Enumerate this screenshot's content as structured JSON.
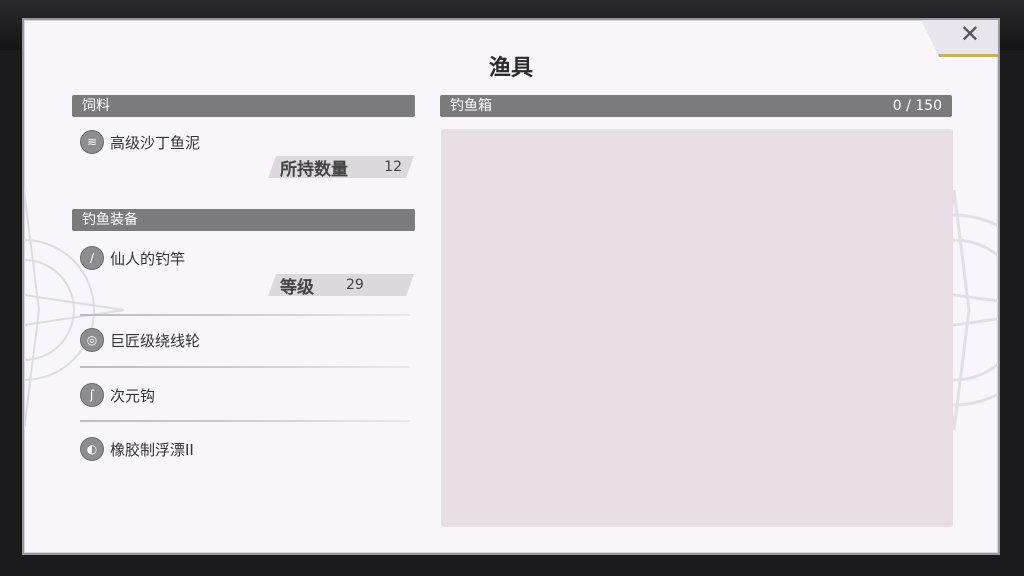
{
  "title": "渔具",
  "close": {
    "icon": "close-icon"
  },
  "bait": {
    "header": "饲料",
    "item": {
      "name": "高级沙丁鱼泥",
      "icon": "bait-icon"
    },
    "stat": {
      "label": "所持数量",
      "value": "12"
    }
  },
  "gear": {
    "header": "钓鱼装备",
    "rod": {
      "name": "仙人的钓竿",
      "icon": "rod-icon",
      "stat": {
        "label": "等级",
        "value": "29"
      }
    },
    "reel": {
      "name": "巨匠级绕线轮",
      "icon": "reel-icon"
    },
    "hook": {
      "name": "次元钩",
      "icon": "hook-icon"
    },
    "float": {
      "name": "橡胶制浮漂II",
      "icon": "float-icon"
    }
  },
  "tackle_box": {
    "header": "钓鱼箱",
    "count": "0 / 150"
  },
  "colors": {
    "panel": "#f8f6fb",
    "header_bar": "#7b7b7e",
    "box_area": "#e6dee4"
  }
}
